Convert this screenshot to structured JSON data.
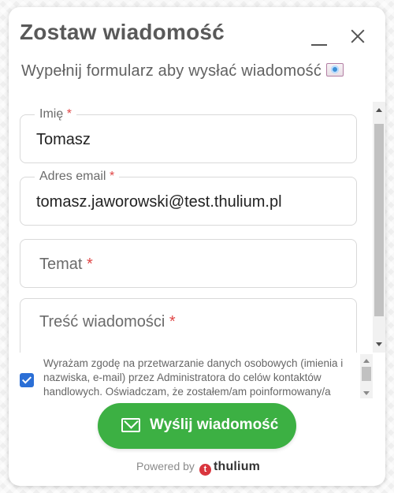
{
  "widget": {
    "title": "Zostaw wiadomość",
    "subtitle": "Wypełnij formularz aby wysłać wiadomość"
  },
  "fields": {
    "name": {
      "label": "Imię",
      "required_mark": "*",
      "value": "Tomasz"
    },
    "email": {
      "label": "Adres email",
      "required_mark": "*",
      "value": "tomasz.jaworowski@test.thulium.pl"
    },
    "subject": {
      "placeholder": "Temat",
      "required_mark": "*"
    },
    "message": {
      "placeholder": "Treść wiadomości",
      "required_mark": "*"
    }
  },
  "consent": {
    "checked": true,
    "text": "Wyrażam zgodę na przetwarzanie danych osobowych (imienia i nazwiska, e-mail) przez Administratora do celów kontaktów handlowych. Oświadczam, że zostałem/am poinformowany/a"
  },
  "send_button": {
    "label": "Wyślij wiadomość"
  },
  "footer": {
    "powered_by": "Powered by",
    "brand_mark": "t",
    "brand_name": "thulium"
  },
  "colors": {
    "accent": "#3cb043",
    "required": "#e04646",
    "checkbox": "#2b6fd6",
    "brand": "#d9363e"
  }
}
